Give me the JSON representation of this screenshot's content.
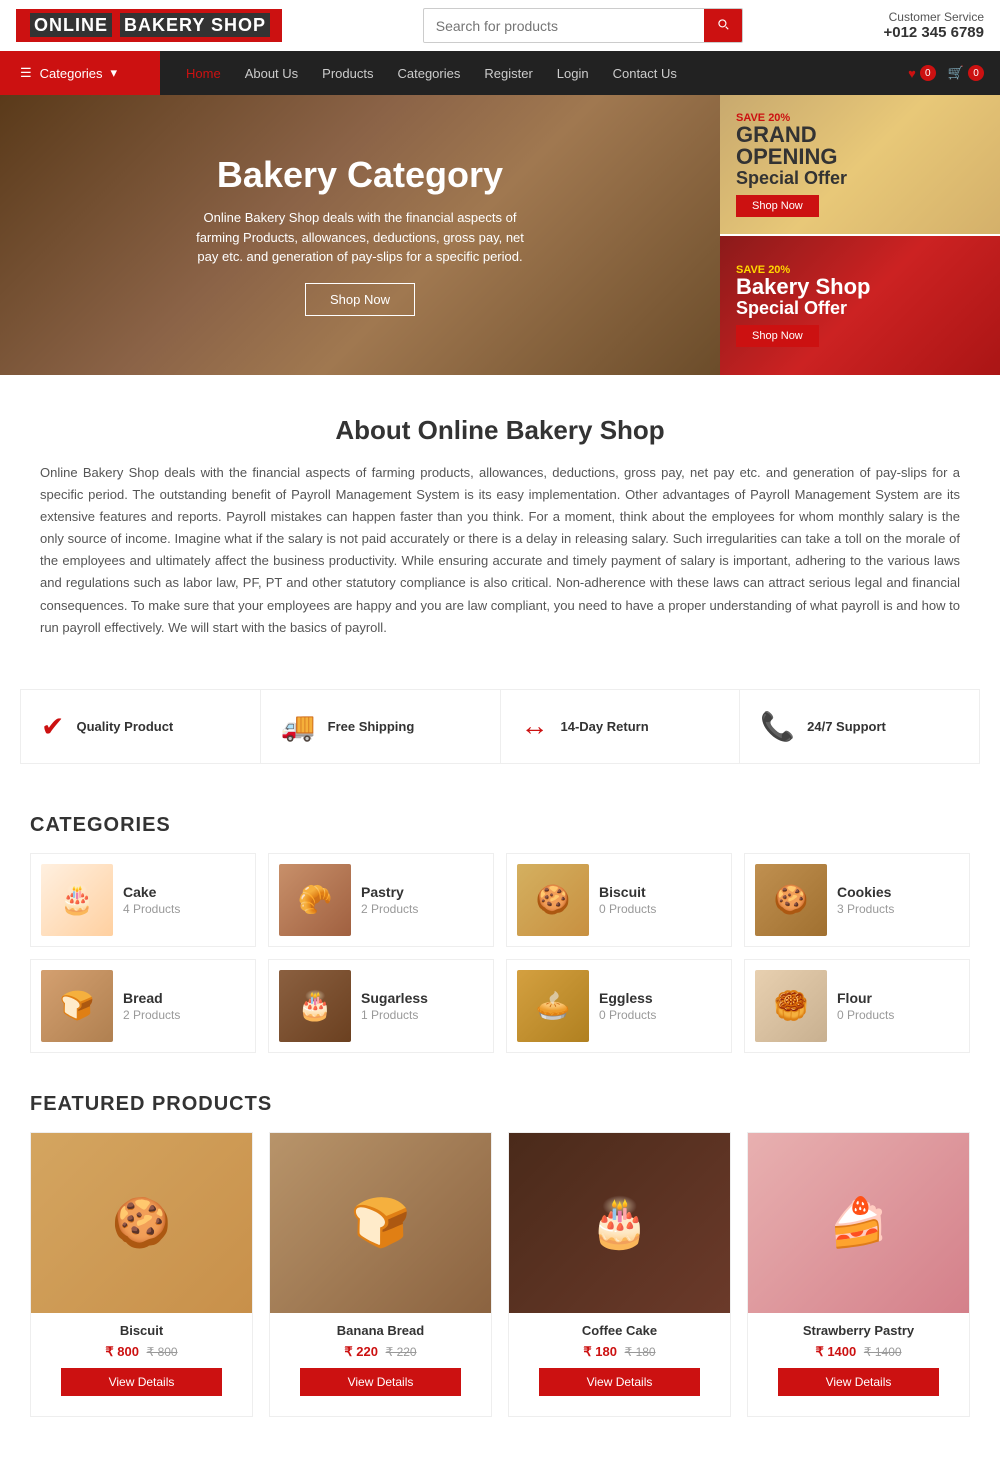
{
  "header": {
    "logo_text": "ONLINE",
    "logo_span": "BAKERY SHOP",
    "search_placeholder": "Search for products",
    "customer_service_label": "Customer Service",
    "phone": "+012 345 6789"
  },
  "nav": {
    "categories_label": "Categories",
    "links": [
      {
        "label": "Home",
        "active": true
      },
      {
        "label": "About Us",
        "active": false
      },
      {
        "label": "Products",
        "active": false
      },
      {
        "label": "Categories",
        "active": false
      },
      {
        "label": "Register",
        "active": false
      },
      {
        "label": "Login",
        "active": false
      },
      {
        "label": "Contact Us",
        "active": false
      }
    ],
    "wishlist_count": "0",
    "cart_count": "0"
  },
  "hero": {
    "main": {
      "title": "Bakery Category",
      "description": "Online Bakery Shop deals with the financial aspects of farming Products, allowances, deductions, gross pay, net pay etc. and generation of pay-slips for a specific period.",
      "shop_now": "Shop Now"
    },
    "card1": {
      "save": "SAVE 20%",
      "grand": "GRAND",
      "opening": "OPENI...",
      "special": "Special Offer",
      "shop_now": "Shop Now"
    },
    "card2": {
      "save": "SAVE 20%",
      "bakery": "Bakery Shop",
      "special": "Special Offer",
      "shop_now": "Shop Now"
    }
  },
  "about": {
    "title": "About Online Bakery Shop",
    "text": "Online Bakery Shop deals with the financial aspects of farming products, allowances, deductions, gross pay, net pay etc. and generation of pay-slips for a specific period. The outstanding benefit of Payroll Management System is its easy implementation. Other advantages of Payroll Management System are its extensive features and reports. Payroll mistakes can happen faster than you think. For a moment, think about the employees for whom monthly salary is the only source of income. Imagine what if the salary is not paid accurately or there is a delay in releasing salary. Such irregularities can take a toll on the morale of the employees and ultimately affect the business productivity. While ensuring accurate and timely payment of salary is important, adhering to the various laws and regulations such as labor law, PF, PT and other statutory compliance is also critical. Non-adherence with these laws can attract serious legal and financial consequences. To make sure that your employees are happy and you are law compliant, you need to have a proper understanding of what payroll is and how to run payroll effectively. We will start with the basics of payroll."
  },
  "features": [
    {
      "icon": "✔",
      "label": "Quality Product"
    },
    {
      "icon": "🚚",
      "label": "Free Shipping"
    },
    {
      "icon": "↔",
      "label": "14-Day Return"
    },
    {
      "icon": "📞",
      "label": "24/7 Support"
    }
  ],
  "categories_section": {
    "title": "CATEGORIES",
    "items": [
      {
        "name": "Cake",
        "count": "4 Products",
        "emoji": "🎂"
      },
      {
        "name": "Pastry",
        "count": "2 Products",
        "emoji": "🥐"
      },
      {
        "name": "Biscuit",
        "count": "0 Products",
        "emoji": "🍪"
      },
      {
        "name": "Cookies",
        "count": "3 Products",
        "emoji": "🍪"
      },
      {
        "name": "Bread",
        "count": "2 Products",
        "emoji": "🍞"
      },
      {
        "name": "Sugarless",
        "count": "1 Products",
        "emoji": "🎂"
      },
      {
        "name": "Eggless",
        "count": "0 Products",
        "emoji": "🥧"
      },
      {
        "name": "Flour",
        "count": "0 Products",
        "emoji": "🥮"
      }
    ]
  },
  "featured_section": {
    "title": "FEATURED PRODUCTS",
    "products": [
      {
        "name": "Biscuit",
        "current_price": "₹ 800",
        "original_price": "₹ 800",
        "btn": "View Details"
      },
      {
        "name": "Banana Bread",
        "current_price": "₹ 220",
        "original_price": "₹ 220",
        "btn": "View Details"
      },
      {
        "name": "Coffee Cake",
        "current_price": "₹ 180",
        "original_price": "₹ 180",
        "btn": "View Details"
      },
      {
        "name": "Strawberry Pastry",
        "current_price": "₹ 1400",
        "original_price": "₹ 1400",
        "btn": "View Details"
      }
    ]
  }
}
